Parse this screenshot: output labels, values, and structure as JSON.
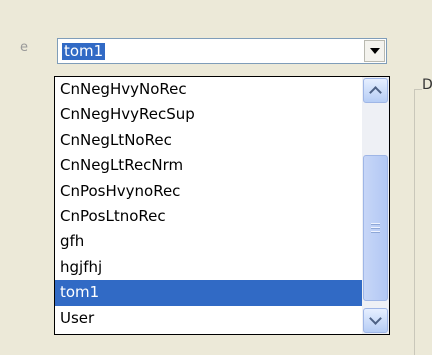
{
  "fragments": {
    "top": "'",
    "left": "e",
    "right": "D"
  },
  "combo": {
    "value": "tom1"
  },
  "dropdown": {
    "items": [
      "CnNegHvyNoRec",
      "CnNegHvyRecSup",
      "CnNegLtNoRec",
      "CnNegLtRecNrm",
      "CnPosHvynoRec",
      "CnPosLtnoRec",
      "gfh",
      "hgjfhj",
      "tom1",
      "User"
    ],
    "selected_index": 8
  }
}
